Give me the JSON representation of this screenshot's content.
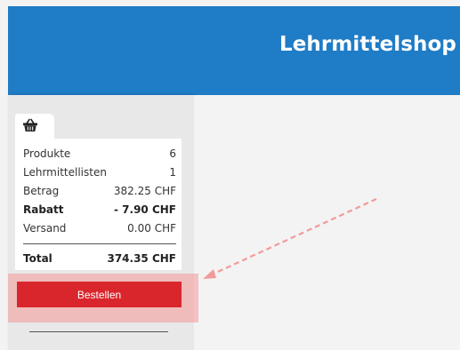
{
  "header": {
    "title": "Lehrmittelshop",
    "color": "#1f7cc6"
  },
  "cart": {
    "tab_icon": "basket-icon",
    "rows": [
      {
        "label": "Produkte",
        "value": "6",
        "bold": false
      },
      {
        "label": "Lehrmittellisten",
        "value": "1",
        "bold": false
      },
      {
        "label": "Betrag",
        "value": "382.25 CHF",
        "bold": false
      },
      {
        "label": "Rabatt",
        "value": "- 7.90 CHF",
        "bold": true
      },
      {
        "label": "Versand",
        "value": "0.00 CHF",
        "bold": false
      }
    ],
    "total_label": "Total",
    "total_value": "374.35 CHF"
  },
  "order_button": {
    "label": "Bestellen",
    "color": "#d9262c"
  },
  "annotation": {
    "arrow_color": "#f29a9a",
    "highlight_color": "#f49696"
  }
}
